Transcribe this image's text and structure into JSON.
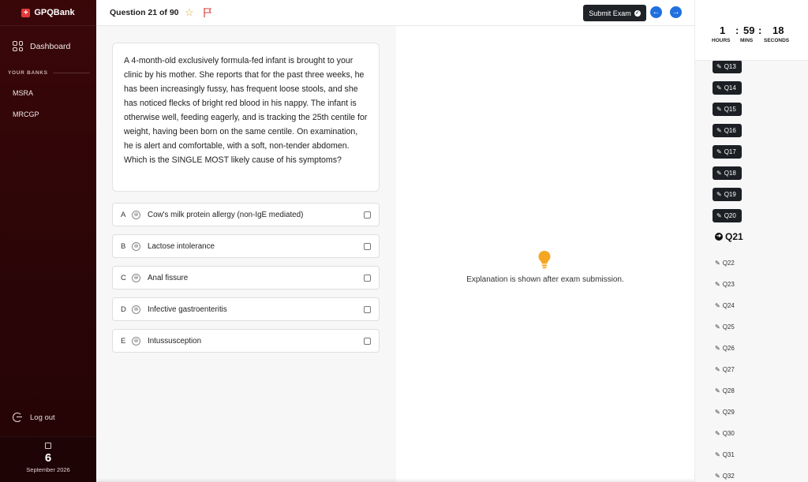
{
  "app": {
    "brand": "GPQBank"
  },
  "sidebar": {
    "dashboard_label": "Dashboard",
    "banks_heading": "YOUR BANKS",
    "banks": [
      {
        "label": "MSRA"
      },
      {
        "label": "MRCGP"
      }
    ],
    "logout_label": "Log out",
    "date": {
      "day": "6",
      "month_year": "September 2026"
    }
  },
  "header": {
    "question_counter": "Question 21 of 90",
    "submit_label": "Submit Exam",
    "star_glyph": "☆",
    "check_glyph": "✓",
    "prev_glyph": "←",
    "next_glyph": "→"
  },
  "question": {
    "stem": "A 4-month-old exclusively formula-fed infant is brought to your clinic by his mother. She reports that for the past three weeks, he has been increasingly fussy, has frequent loose stools, and she has noticed flecks of bright red blood in his nappy. The infant is otherwise well, feeding eagerly, and is tracking the 25th centile for weight, having been born on the same centile. On examination, he is alert and comfortable, with a soft, non-tender abdomen. Which is the SINGLE MOST likely cause of his symptoms?",
    "options": [
      {
        "letter": "A",
        "text": "Cow's milk protein allergy (non-IgE mediated)"
      },
      {
        "letter": "B",
        "text": "Lactose intolerance"
      },
      {
        "letter": "C",
        "text": "Anal fissure"
      },
      {
        "letter": "D",
        "text": "Infective gastroenteritis"
      },
      {
        "letter": "E",
        "text": "Intussusception"
      }
    ],
    "strike_glyph": "⊗"
  },
  "explanation": {
    "text": "Explanation is shown after exam submission."
  },
  "timer": {
    "hours": "1",
    "mins": "59",
    "seconds": "18",
    "sep": ":",
    "hours_label": "HOURS",
    "mins_label": "MINS",
    "seconds_label": "SECONDS"
  },
  "question_nav": {
    "pencil_glyph": "✎",
    "current_glyph": "➔",
    "items": [
      {
        "label": "Q13",
        "state": "answered"
      },
      {
        "label": "Q14",
        "state": "answered"
      },
      {
        "label": "Q15",
        "state": "answered"
      },
      {
        "label": "Q16",
        "state": "answered"
      },
      {
        "label": "Q17",
        "state": "answered"
      },
      {
        "label": "Q18",
        "state": "answered"
      },
      {
        "label": "Q19",
        "state": "answered"
      },
      {
        "label": "Q20",
        "state": "answered"
      },
      {
        "label": "Q21",
        "state": "current"
      },
      {
        "label": "Q22",
        "state": "unanswered"
      },
      {
        "label": "Q23",
        "state": "unanswered"
      },
      {
        "label": "Q24",
        "state": "unanswered"
      },
      {
        "label": "Q25",
        "state": "unanswered"
      },
      {
        "label": "Q26",
        "state": "unanswered"
      },
      {
        "label": "Q27",
        "state": "unanswered"
      },
      {
        "label": "Q28",
        "state": "unanswered"
      },
      {
        "label": "Q29",
        "state": "unanswered"
      },
      {
        "label": "Q30",
        "state": "unanswered"
      },
      {
        "label": "Q31",
        "state": "unanswered"
      },
      {
        "label": "Q32",
        "state": "unanswered"
      }
    ]
  },
  "colors": {
    "sidebar_bg": "#2a0507",
    "accent_blue": "#1f6fe0",
    "submit_bg": "#1f2227",
    "bulb": "#f5a623"
  }
}
